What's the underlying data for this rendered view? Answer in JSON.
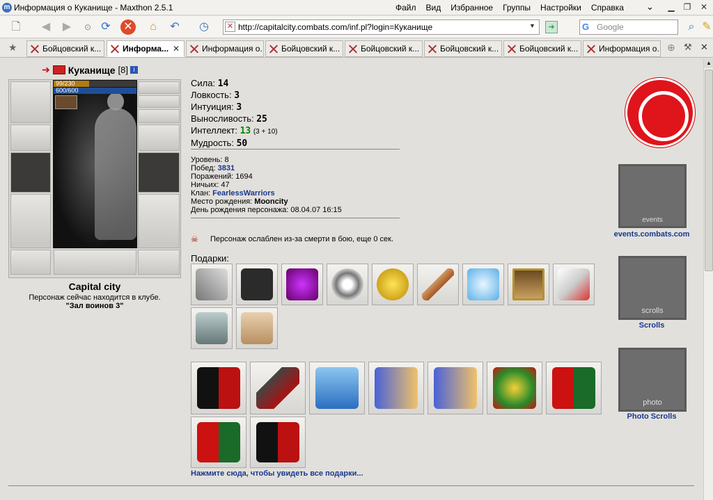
{
  "window": {
    "title": "Информация о Куканище - Maxthon 2.5.1",
    "app_icon": "maxthon-icon"
  },
  "menu": [
    "Файл",
    "Вид",
    "Избранное",
    "Группы",
    "Настройки",
    "Справка"
  ],
  "toolbar": {
    "address": "http://capitalcity.combats.com/inf.pl?login=Куканище",
    "search_placeholder": "Google"
  },
  "tabs": [
    "Бойцовский к...",
    "Информа...",
    "Информация о...",
    "Бойцовский к...",
    "Бойцовский к...",
    "Бойцовский к...",
    "Бойцовский к...",
    "Информация о..."
  ],
  "character": {
    "name": "Куканище",
    "level": "[8]",
    "hp": "99/230",
    "hp_fraction": 0.43,
    "mp": "600/600",
    "city": "Capital city",
    "club_line": "Персонаж сейчас находится в клубе.",
    "club_room": "\"Зал воинов 3\""
  },
  "stats": {
    "sila_label": "Сила:",
    "sila": "14",
    "lovkost_label": "Ловкость:",
    "lovkost": "3",
    "intuit_label": "Интуиция:",
    "intuit": "3",
    "vynos_label": "Выносливость:",
    "vynos": "25",
    "intel_label": "Интеллект:",
    "intel": "13",
    "intel_extra": "(3 + 10)",
    "mudr_label": "Мудрость:",
    "mudr": "50"
  },
  "details": {
    "level_label": "Уровень:",
    "level": "8",
    "wins_label": "Побед:",
    "wins": "3831",
    "losses_label": "Поражений:",
    "losses": "1694",
    "draws_label": "Ничьих:",
    "draws": "47",
    "clan_label": "Клан:",
    "clan": "FearlessWarriors",
    "born_label": "Место рождения:",
    "born": "Mooncity",
    "bday_label": "День рождения персонажа:",
    "bday": "08.04.07 16:15"
  },
  "weakened": "Персонаж ослаблен из-за смерти в бою, еще 0 сек.",
  "gifts_label": "Подарки:",
  "all_gifts_link": "Нажмите сюда, чтобы увидеть все подарки...",
  "banners": {
    "events_label": "events.combats.com",
    "scrolls_label": "Scrolls",
    "photo_label": "Photo Scrolls",
    "events_text": "events",
    "scrolls_text": "scrolls",
    "photo_text": "photo"
  }
}
